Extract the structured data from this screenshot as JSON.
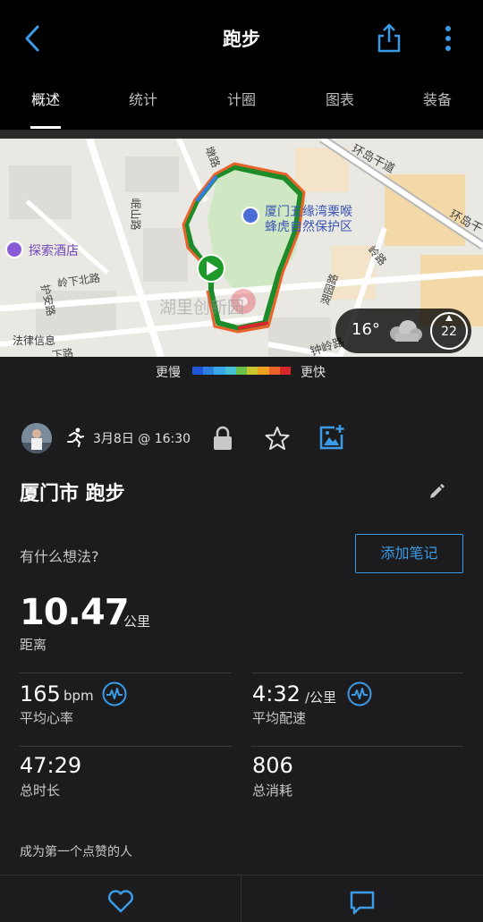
{
  "header": {
    "title": "跑步",
    "icons": {
      "back": "chevron-left-icon",
      "share": "share-icon",
      "more": "more-vertical-icon"
    }
  },
  "tabs": [
    {
      "label": "概述",
      "active": true
    },
    {
      "label": "统计",
      "active": false
    },
    {
      "label": "计圈",
      "active": false
    },
    {
      "label": "图表",
      "active": false
    },
    {
      "label": "装备",
      "active": false
    }
  ],
  "map": {
    "labels": {
      "huandao": "环岛干道",
      "huandao2": "环岛干",
      "park_line1": "厦门五缘湾栗喉",
      "park_line2": "蜂虎自然保护区",
      "hotel": "探索酒店",
      "watermark": "湖里创新园",
      "law_info": "法律信息",
      "minglan": "岷山路",
      "linglu": "岭下北路",
      "huanan": "护安路",
      "zhongling": "钟岭路",
      "huyuan": "湖园路",
      "dizhong": "墩路",
      "ling": "岭路",
      "road_bottom": "下路"
    },
    "weather": {
      "temperature": "16°",
      "wind": "22",
      "icon": "cloud-icon"
    }
  },
  "legend": {
    "slow": "更慢",
    "fast": "更快",
    "colors": [
      "#1f55d6",
      "#2f7fe0",
      "#39a8e8",
      "#44c0d4",
      "#6cc04a",
      "#c8c82e",
      "#f0a020",
      "#e8622a",
      "#d8262a"
    ]
  },
  "activity": {
    "date": "3月8日 @ 16:30",
    "title": "厦门市 跑步",
    "thoughts_prompt": "有什么想法?",
    "add_note_label": "添加笔记"
  },
  "stats": {
    "distance": {
      "value": "10.47",
      "unit": "公里",
      "label": "距离"
    },
    "heart_rate": {
      "value": "165",
      "unit": "bpm",
      "label": "平均心率"
    },
    "pace": {
      "value": "4:32",
      "unit": "/公里",
      "label": "平均配速"
    },
    "duration": {
      "value": "47:29",
      "label": "总时长"
    },
    "calories": {
      "value": "806",
      "label": "总消耗"
    }
  },
  "social": {
    "likes_text": "成为第一个点赞的人"
  },
  "accent": "#3b9be6"
}
